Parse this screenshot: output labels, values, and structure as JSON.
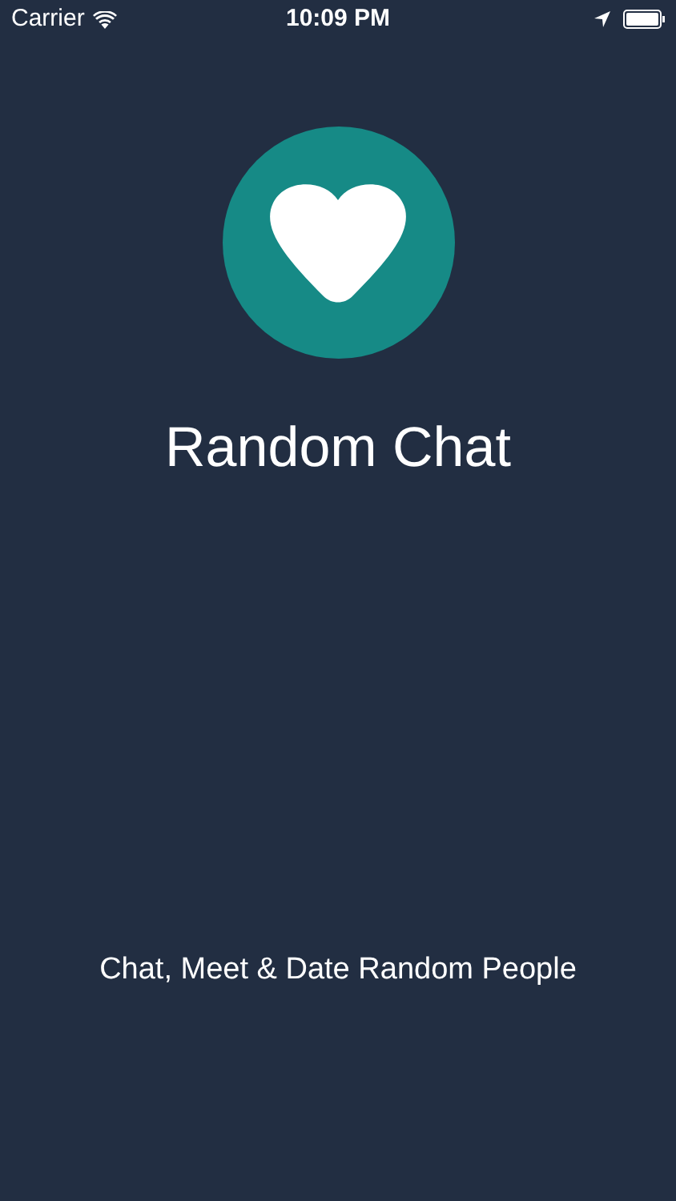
{
  "status_bar": {
    "carrier": "Carrier",
    "time": "10:09 PM"
  },
  "app": {
    "title": "Random Chat",
    "tagline": "Chat, Meet & Date Random People"
  }
}
